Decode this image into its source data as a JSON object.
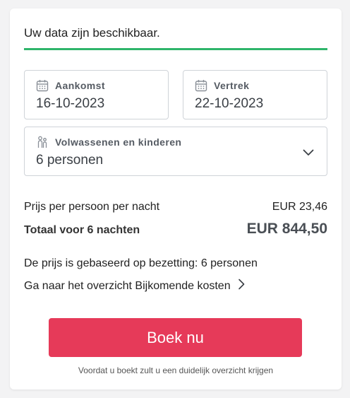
{
  "availability_message": "Uw data zijn beschikbaar.",
  "arrival": {
    "label": "Aankomst",
    "value": "16-10-2023",
    "icon": "calendar-icon"
  },
  "departure": {
    "label": "Vertrek",
    "value": "22-10-2023",
    "icon": "calendar-icon"
  },
  "guests": {
    "label": "Volwassenen en kinderen",
    "value": "6 personen",
    "icon": "people-icon"
  },
  "pricing": {
    "per_person_label": "Prijs per persoon per nacht",
    "per_person_amount": "EUR 23,46",
    "total_label": "Totaal voor 6 nachten",
    "total_amount": "EUR 844,50"
  },
  "occupancy_note": "De prijs is gebaseerd op bezetting: 6 personen",
  "overview_link": "Ga naar het overzicht Bijkomende kosten",
  "book_button": "Boek nu",
  "footnote": "Voordat u boekt zult u een duidelijk overzicht krijgen",
  "colors": {
    "accent_green": "#2fb56b",
    "button_red": "#e63a59"
  }
}
